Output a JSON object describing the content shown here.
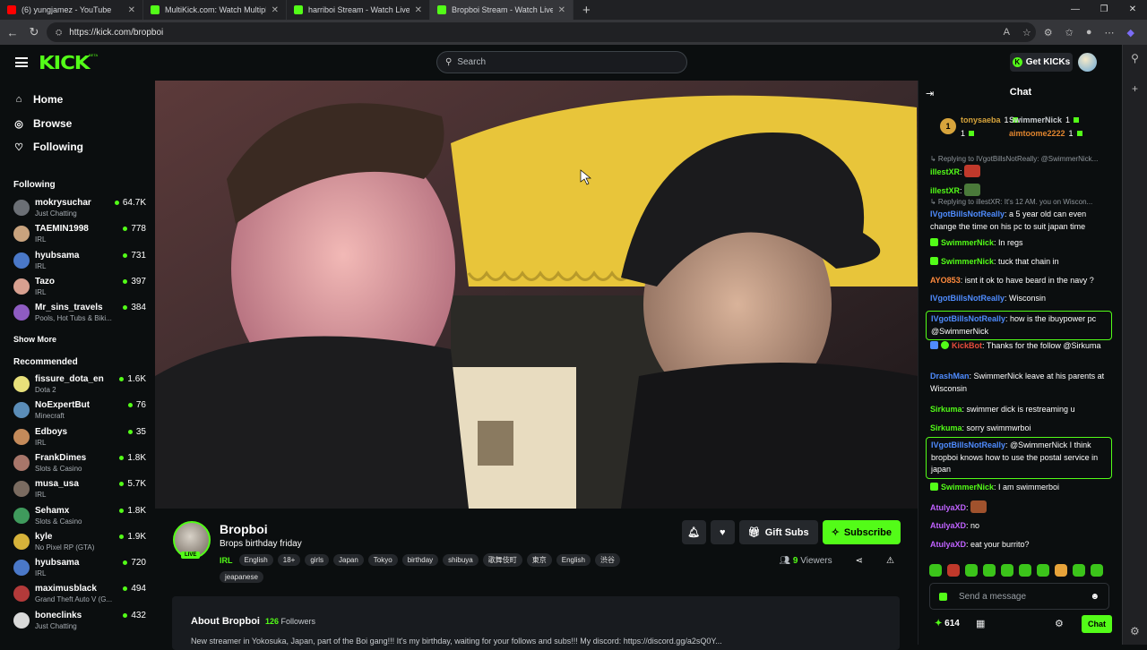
{
  "browser": {
    "tabs": [
      {
        "title": "(6) yungjamez - YouTube",
        "color": "#ff0000",
        "active": false
      },
      {
        "title": "MultiKick.com: Watch Multiple St",
        "color": "#53fc18",
        "active": false
      },
      {
        "title": "harriboi Stream - Watch Live on K",
        "color": "#53fc18",
        "active": false
      },
      {
        "title": "Bropboi Stream - Watch Live",
        "color": "#53fc18",
        "active": true
      }
    ],
    "new_tab": "+",
    "url": "https://kick.com/bropboi"
  },
  "header": {
    "logo": "KICK",
    "beta": "BETA",
    "search_placeholder": "Search",
    "get_kicks": "Get KICKs"
  },
  "sidebar": {
    "nav": [
      {
        "label": "Home",
        "icon": "home-icon"
      },
      {
        "label": "Browse",
        "icon": "compass-icon"
      },
      {
        "label": "Following",
        "icon": "heart-icon"
      }
    ],
    "following_title": "Following",
    "following": [
      {
        "name": "mokrysuchar",
        "cat": "Just Chatting",
        "viewers": "64.7K",
        "color": "#6b6f75"
      },
      {
        "name": "TAEMIN1998",
        "cat": "IRL",
        "viewers": "778",
        "color": "#c9a37e"
      },
      {
        "name": "hyubsama",
        "cat": "IRL",
        "viewers": "731",
        "color": "#4a78c8"
      },
      {
        "name": "Tazo",
        "cat": "IRL",
        "viewers": "397",
        "color": "#d8a090"
      },
      {
        "name": "Mr_sins_travels",
        "cat": "Pools, Hot Tubs & Biki...",
        "viewers": "384",
        "color": "#8e5cc2"
      }
    ],
    "show_more": "Show More",
    "recommended_title": "Recommended",
    "recommended": [
      {
        "name": "fissure_dota_en",
        "cat": "Dota 2",
        "viewers": "1.6K",
        "color": "#e8e07a"
      },
      {
        "name": "NoExpertBut",
        "cat": "Minecraft",
        "viewers": "76",
        "color": "#5b8db8"
      },
      {
        "name": "Edboys",
        "cat": "IRL",
        "viewers": "35",
        "color": "#c48a5a"
      },
      {
        "name": "FrankDimes",
        "cat": "Slots & Casino",
        "viewers": "1.8K",
        "color": "#a8766a"
      },
      {
        "name": "musa_usa",
        "cat": "IRL",
        "viewers": "5.7K",
        "color": "#7a6b60"
      },
      {
        "name": "Sehamx",
        "cat": "Slots & Casino",
        "viewers": "1.8K",
        "color": "#3f9a5c"
      },
      {
        "name": "kyle",
        "cat": "No Pixel RP (GTA)",
        "viewers": "1.9K",
        "color": "#d6b23a"
      },
      {
        "name": "hyubsama",
        "cat": "IRL",
        "viewers": "720",
        "color": "#4a78c8"
      },
      {
        "name": "maximusblack",
        "cat": "Grand Theft Auto V (G...",
        "viewers": "494",
        "color": "#b33a3a"
      },
      {
        "name": "boneclinks",
        "cat": "Just Chatting",
        "viewers": "432",
        "color": "#d9d9d9"
      }
    ]
  },
  "stream": {
    "name": "Bropboi",
    "live": "LIVE",
    "title": "Brops birthday friday",
    "category": "IRL",
    "tags": [
      "English",
      "18+",
      "girls",
      "Japan",
      "Tokyo",
      "birthday",
      "shibuya",
      "歌舞伎町",
      "東京",
      "English",
      "渋谷"
    ],
    "tags2": [
      "jeapanese"
    ],
    "gift_subs": "Gift Subs",
    "subscribe": "Subscribe",
    "viewers_count": "9",
    "viewers_label": "Viewers",
    "about_title": "About Bropboi",
    "followers_count": "126",
    "followers_label": "Followers",
    "about_text": "New streamer in Yokosuka, Japan, part of the Boi gang!!! It's my birthday, waiting for your follows and subs!!! My discord: https://discord.gg/a2sQ0Y..."
  },
  "chat": {
    "title": "Chat",
    "gifters": [
      {
        "name": "tonysaeba",
        "count": "1",
        "color": "#d7a43c"
      },
      {
        "name": "SwimmerNick",
        "count": "1",
        "color": "#c9cdd1"
      },
      {
        "name": "aimtoome2222",
        "count": "1",
        "color": "#e0852f"
      }
    ],
    "messages": [
      {
        "type": "reply",
        "text": "↳ Replying to IVgotBillsNotReally: @SwimmerNick..."
      },
      {
        "user": "illestXR",
        "color": "#53fc18",
        "text": "",
        "emote": "#c0392b"
      },
      {
        "user": "illestXR",
        "color": "#53fc18",
        "text": "",
        "emote": "#4a7a3a"
      },
      {
        "type": "reply",
        "text": "↳ Replying to illestXR: It's 12 AM. you on Wiscon..."
      },
      {
        "user": "IVgotBillsNotReally",
        "color": "#4f8cff",
        "text": "a 5 year old can even change the time on his pc to suit japan time"
      },
      {
        "user": "SwimmerNick",
        "color": "#53fc18",
        "text": "In regs",
        "badge": true
      },
      {
        "user": "SwimmerNick",
        "color": "#53fc18",
        "text": "tuck that chain in",
        "badge": true
      },
      {
        "user": "AYO853",
        "color": "#ff8a3d",
        "text": "isnt it ok to have beard in the navy ?"
      },
      {
        "user": "IVgotBillsNotReally",
        "color": "#4f8cff",
        "text": "Wisconsin"
      },
      {
        "user": "IVgotBillsNotReally",
        "color": "#4f8cff",
        "text": "how is the ibuypower pc @SwimmerNick",
        "highlight": true
      },
      {
        "user": "KickBot",
        "color": "#e74c3c",
        "text": "Thanks for the follow @Sirkuma",
        "bot": true
      },
      {
        "user": "DrashMan",
        "color": "#4f8cff",
        "text": "SwimmerNick leave at his parents at Wisconsin"
      },
      {
        "user": "Sirkuma",
        "color": "#53fc18",
        "text": "swimmer dick is restreaming u"
      },
      {
        "user": "Sirkuma",
        "color": "#53fc18",
        "text": "sorry swimmwrboi"
      },
      {
        "user": "IVgotBillsNotReally",
        "color": "#4f8cff",
        "text": "@SwimmerNick I think bropboi knows how to use the postal service in japan",
        "highlight": true
      },
      {
        "user": "SwimmerNick",
        "color": "#53fc18",
        "text": "I am swimmerboi",
        "badge": true
      },
      {
        "user": "AtulyaXD",
        "color": "#c062ff",
        "text": "",
        "emote": "#a0522d"
      },
      {
        "user": "AtulyaXD",
        "color": "#c062ff",
        "text": "no"
      },
      {
        "user": "AtulyaXD",
        "color": "#c062ff",
        "text": "eat your burrito?"
      }
    ],
    "input_placeholder": "Send a message",
    "kicks": "614",
    "chat_button": "Chat"
  }
}
